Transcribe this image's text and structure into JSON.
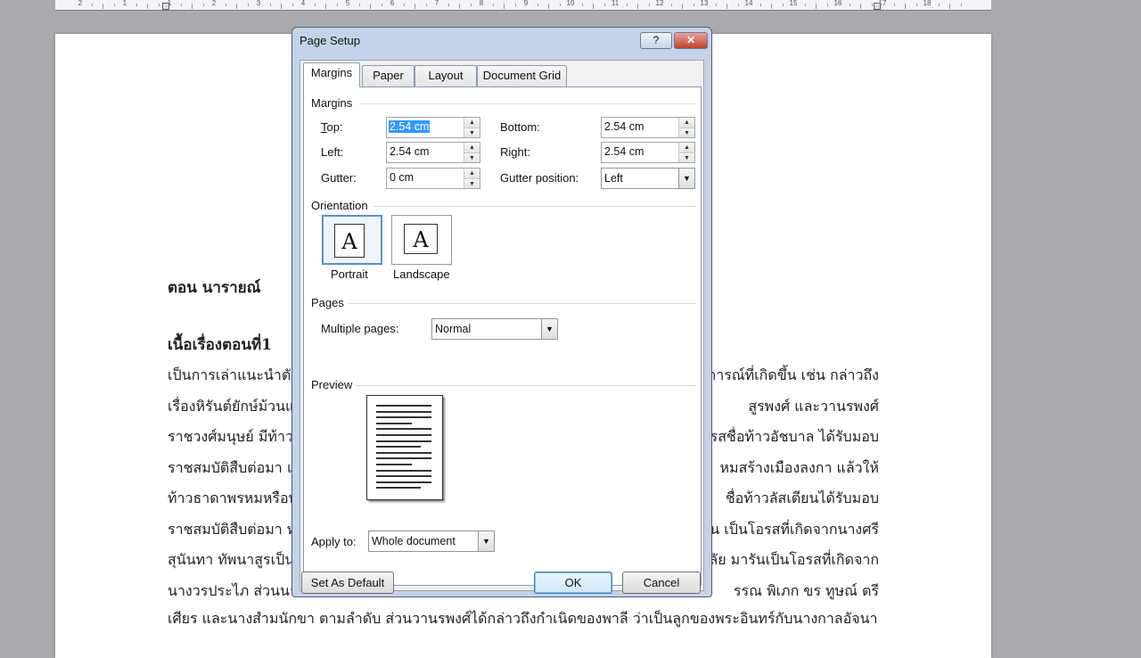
{
  "ruler": {
    "numbers": [
      "2",
      "1",
      "1",
      "2",
      "3",
      "4",
      "5",
      "6",
      "7",
      "8",
      "9",
      "10",
      "11",
      "12",
      "13",
      "14",
      "15",
      "16",
      "17",
      "18"
    ]
  },
  "document": {
    "heading": "ตอน นารายณ์",
    "subheading": "เนื้อเรื่องตอนที่1",
    "lines_left": [
      "เป็นการเล่าแนะนำตั",
      "เรื่องหิรันต์ยักษ์ม้วนแ",
      "ราชวงศ์มนุษย์ มีท้าว",
      "ราชสมบัติสืบต่อมา แ",
      "ท้าวธาดาพรหมหรือท่",
      "ราชสมบัติสืบต่อมา ท่",
      "สุนันทา ทัพนาสูรเป็น",
      "นางวรประไภ ส่วนนา"
    ],
    "lines_right": [
      "การณ์ที่เกิดขึ้น เช่น กล่าวถึง",
      "สูรพงศ์ และวานรพงศ์",
      "รสชื่อท้าวอัชบาล ได้รับมอบ",
      "หมสร้างเมืองลงกา แล้วให้",
      "ชื่อท้าวลัสเตียนได้รับมอบ",
      "น เป็นโอรสที่เกิดจากนางศรี",
      "ลัย มารันเป็นโอรสที่เกิดจาก",
      "รรณ พิเภก ขร ทูษณ์ ตรี"
    ],
    "full_line": "เศียร และนางสำมนักขา ตามลำดับ ส่วนวานรพงศ์ได้กล่าวถึงกำเนิดของพาลี ว่าเป็นลูกของพระอินทร์กับนางกาลอัจนา"
  },
  "dialog": {
    "title": "Page Setup",
    "help_label": "?",
    "close_label": "✕",
    "tabs": [
      {
        "label": "Margins",
        "active": true
      },
      {
        "label": "Paper",
        "active": false
      },
      {
        "label": "Layout",
        "active": false
      },
      {
        "label": "Document Grid",
        "active": false
      }
    ],
    "margins": {
      "section": "Margins",
      "top_label": "Top:",
      "top_value": "2.54 cm",
      "bottom_label": "Bottom:",
      "bottom_value": "2.54 cm",
      "left_label": "Left:",
      "left_value": "2.54 cm",
      "right_label": "Right:",
      "right_value": "2.54 cm",
      "gutter_label": "Gutter:",
      "gutter_value": "0 cm",
      "gutter_position_label": "Gutter position:",
      "gutter_position_value": "Left"
    },
    "orientation": {
      "section": "Orientation",
      "portrait_label": "Portrait",
      "landscape_label": "Landscape",
      "icon_letter": "A",
      "selected": "Portrait"
    },
    "pages": {
      "section": "Pages",
      "multiple_pages_label": "Multiple pages:",
      "multiple_pages_value": "Normal"
    },
    "preview": {
      "section": "Preview",
      "apply_to_label": "Apply to:",
      "apply_to_value": "Whole document"
    },
    "buttons": {
      "set_default": "Set As Default",
      "ok": "OK",
      "cancel": "Cancel"
    }
  },
  "colors": {
    "selection": "#3399ff",
    "dialog_frame": "#c4d3e8",
    "close_button": "#c3402f"
  }
}
